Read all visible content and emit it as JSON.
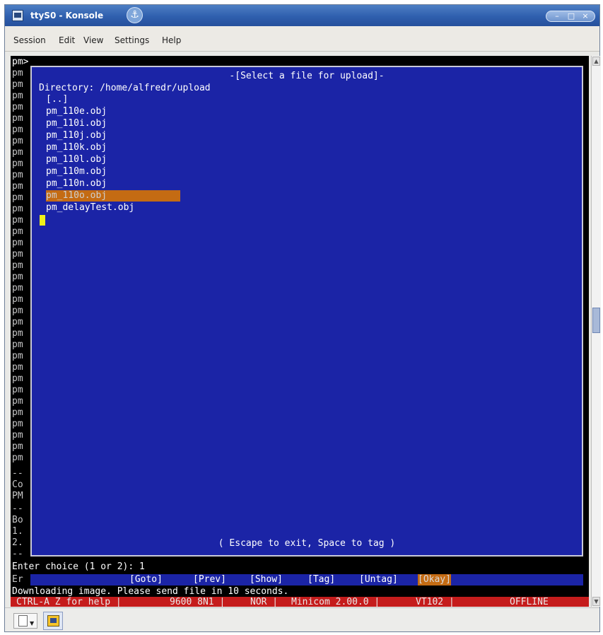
{
  "window": {
    "title": "ttyS0 - Konsole",
    "icons": {
      "app": "konsole-app-icon",
      "sticky": "sticky-pin-icon"
    },
    "controls": {
      "minimize": "–",
      "maximize": "□",
      "close": "×"
    }
  },
  "menubar": {
    "items": [
      "Session",
      "Edit",
      "View",
      "Settings",
      "Help"
    ]
  },
  "terminal": {
    "prompt_line": "pm>",
    "left_column": [
      "pm",
      "pm",
      "pm",
      "pm",
      "pm",
      "pm",
      "pm",
      "pm",
      "pm",
      "pm",
      "pm",
      "pm",
      "pm",
      "pm",
      "pm",
      "pm",
      "pm",
      "pm",
      "pm",
      "pm",
      "pm",
      "pm",
      "pm",
      "pm",
      "pm",
      "pm",
      "pm",
      "pm",
      "pm",
      "pm",
      "pm",
      "pm",
      "pm",
      "pm",
      "pm",
      "--",
      "Co",
      "PM",
      "--",
      "Bo",
      "1.",
      "2.",
      "--"
    ],
    "dialog": {
      "title": "-[Select a file for upload]-",
      "directory": "Directory: /home/alfredr/upload",
      "entries": [
        "[..]",
        "pm_110e.obj",
        "pm_110i.obj",
        "pm_110j.obj",
        "pm_110k.obj",
        "pm_110l.obj",
        "pm_110m.obj",
        "pm_110n.obj",
        "pm_110o.obj",
        "pm_delayTest.obj"
      ],
      "selected_index": 8,
      "hint": "( Escape to exit, Space to tag )"
    },
    "enter_choice": "Enter choice (1 or 2): 1",
    "action_prefix": "Er",
    "actions": [
      "[Goto]",
      "[Prev]",
      "[Show]",
      "[Tag]",
      "[Untag]",
      "[Okay]"
    ],
    "active_action_index": 5,
    "downloading": "Downloading image. Please send file in 10 seconds.",
    "status": [
      "CTRL-A Z for help |",
      "9600 8N1 |",
      "NOR |",
      "Minicom 2.00.0 |",
      "VT102 |",
      "OFFLINE"
    ]
  },
  "scrollbar": {
    "up": "▲",
    "down": "▼"
  },
  "bottombar": {
    "new_session_icon": "new-session-icon",
    "session_icon": "konsole-session-icon"
  },
  "colors": {
    "titlebar": "#2f5fae",
    "dialog_bg": "#1b24a6",
    "selection": "#c46b13",
    "status_bar": "#c51c1c",
    "terminal_bg": "#000000"
  }
}
